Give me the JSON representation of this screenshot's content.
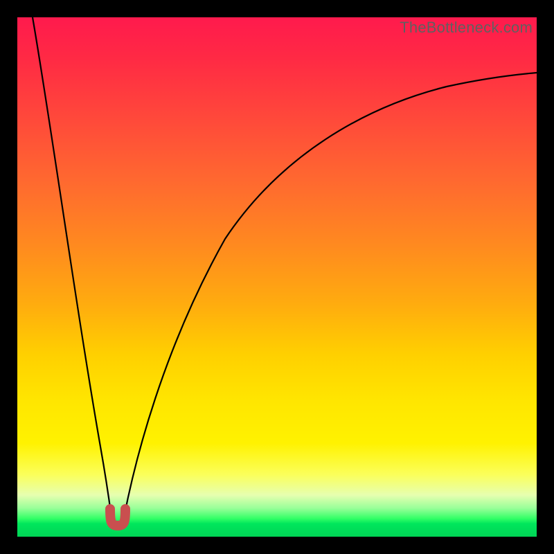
{
  "watermark": "TheBottleneck.com",
  "colors": {
    "frame": "#000000",
    "gradient_top": "#ff1a4d",
    "gradient_mid": "#ffe600",
    "gradient_bottom": "#00d455",
    "curve": "#000000",
    "marker": "#c94f4f"
  },
  "chart_data": {
    "type": "line",
    "title": "",
    "xlabel": "",
    "ylabel": "",
    "x_range": [
      0,
      100
    ],
    "y_range": [
      0,
      100
    ],
    "min_marker_x_range": [
      17.5,
      20.0
    ],
    "series": [
      {
        "name": "left-branch",
        "x": [
          3.0,
          5.0,
          7.0,
          9.0,
          11.0,
          13.0,
          15.0,
          16.5,
          17.5
        ],
        "y": [
          100.0,
          86.0,
          72.0,
          58.5,
          45.0,
          32.0,
          19.0,
          10.0,
          3.5
        ]
      },
      {
        "name": "right-branch",
        "x": [
          20.0,
          22.0,
          25.0,
          29.0,
          34.0,
          40.0,
          47.0,
          55.0,
          64.0,
          74.0,
          85.0,
          100.0
        ],
        "y": [
          3.5,
          12.0,
          23.0,
          35.0,
          46.5,
          57.0,
          65.5,
          72.5,
          78.0,
          82.3,
          85.5,
          88.5
        ]
      }
    ],
    "annotations": [
      {
        "text": "TheBottleneck.com",
        "position": "top-right"
      }
    ],
    "legend": false,
    "grid": false
  }
}
